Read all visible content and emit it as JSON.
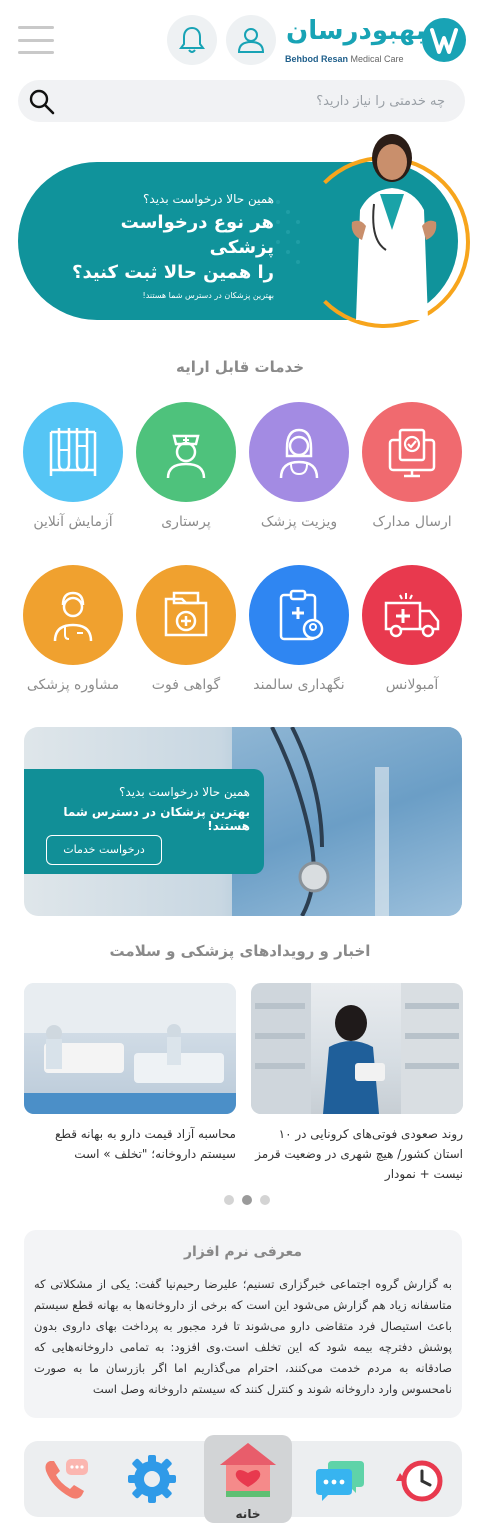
{
  "header": {
    "logo_text": "بهبودرسان",
    "logo_en_brand": "Behbod Resan",
    "logo_en_tagline": "Medical Care"
  },
  "search": {
    "placeholder": "چه خدمتی را نیاز دارید؟"
  },
  "hero": {
    "question": "همین حالا درخواست بدید؟",
    "headline_1": "هر نوع درخواست پزشکی",
    "headline_2": "را همین حالا ثبت کنید؟",
    "subtext": "بهترین پزشکان در دسترس شما هستند!"
  },
  "services": {
    "title": "خدمات قابل ارایه",
    "items": [
      {
        "label": "ارسال مدارک",
        "color": "#f06a6f"
      },
      {
        "label": "ویزیت پزشک",
        "color": "#a38be3"
      },
      {
        "label": "پرستاری",
        "color": "#4ec27c"
      },
      {
        "label": "آزمایش آنلاین",
        "color": "#55c5f5"
      },
      {
        "label": "آمبولانس",
        "color": "#e8394e"
      },
      {
        "label": "نگهداری سالمند",
        "color": "#2f86f2"
      },
      {
        "label": "گواهی فوت",
        "color": "#f0a12f"
      },
      {
        "label": "مشاوره پزشکی",
        "color": "#f0a12f"
      }
    ]
  },
  "promo": {
    "question": "همین حالا درخواست بدید؟",
    "bold": "بهترین پزشکان در دسترس شما هستند!",
    "button": "درخواست خدمات"
  },
  "news": {
    "title": "اخبار و رویدادهای پزشکی و سلامت",
    "items": [
      {
        "text": "روند صعودی فوتی‌های کرونایی در ۱۰ استان کشور/ هیچ شهری در وضعیت قرمز نیست + نمودار"
      },
      {
        "text": "محاسبه آزاد قیمت دارو به بهانه قطع سیستم داروخانه؛ \"تخلف » است"
      }
    ]
  },
  "about": {
    "title": "معرفی نرم افزار",
    "body": "به گزارش گروه اجتماعی خبرگزاری تسنیم؛ علیرضا رحیم‌نیا گفت: یکی از مشکلاتی که متاسفانه زیاد هم گزارش می‌شود این است که برخی از داروخانه‌ها به بهانه قطع سیستم باعث استیصال فرد متقاضی دارو می‌شوند تا فرد مجبور به پرداخت بهای داروی بدون پوشش دفترچه بیمه شود که این تخلف است.وی افزود: به تمامی داروخانه‌هایی که صادقانه به مردم خدمت می‌کنند، احترام می‌گذاریم اما اگر بازرسان ما به صورت نامحسوس وارد داروخانه شوند و کنترل کنند که سیستم داروخانه وصل است"
  },
  "bottom_nav": {
    "home_label": "خانه"
  }
}
